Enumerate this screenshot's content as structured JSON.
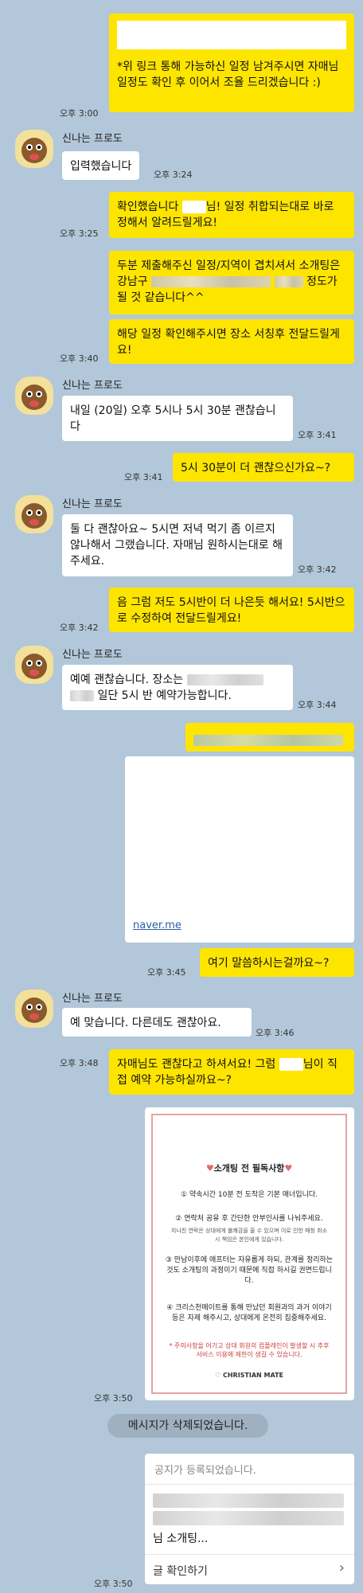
{
  "messages": {
    "m1_text": "*위 링크 통해 가능하신 일정 남겨주시면 자매님 일정도 확인 후 이어서 조율 드리겠습니다 :)",
    "m1_time": "오후 3:00",
    "sender_name": "신나는 프로도",
    "m2_text": "입력했습니다",
    "m2_time": "오후 3:24",
    "m3_text_a": "확인했습니다",
    "m3_text_b": "님! 일정 취합되는대로 바로 정해서 알려드릴게요!",
    "m3_time": "오후 3:25",
    "m4_text_a": "두분 제출해주신 일정/지역이 겹치셔서 소개팅은 강남구",
    "m4_text_b": "정도가 될 것 같습니다^^",
    "m5_text": "해당 일정 확인해주시면 장소 서칭후 전달드릴게요!",
    "m5_time": "오후 3:40",
    "m6_text": "내일 (20일) 오후 5시나 5시 30분 괜찮습니다",
    "m6_time": "오후 3:41",
    "m7_text": "5시 30분이 더 괜찮으신가요~?",
    "m7_time": "오후 3:41",
    "m8_text": "둘 다 괜찮아요~ 5시면 저녁 먹기 좀 이르지 않나해서 그랬습니다. 자매님 원하시는대로 해주세요.",
    "m8_time": "오후 3:42",
    "m9_text": "음 그럼 저도 5시반이 더 나은듯 해서요! 5시반으로 수정하여 전달드릴게요!",
    "m9_time": "오후 3:42",
    "m10_text_a": "예예 괜찮습니다. 장소는",
    "m10_text_b": "일단 5시 반 예약가능합니다.",
    "m10_time": "오후 3:44",
    "link_domain": "naver.me",
    "link_time": "오후 3:45",
    "m11_text": "여기 말씀하시는걸까요~?",
    "m12_text": "예 맞습니다. 다른데도 괜찮아요.",
    "m12_time": "오후 3:46",
    "m13_text_a": "자매님도 괜찮다고 하셔서요! 그럼",
    "m13_text_b": "님이 직접 예약 가능하실까요~?",
    "m13_time": "오후 3:48",
    "image_time": "오후 3:50",
    "deleted_text": "메시지가 삭제되었습니다.",
    "notice_header": "공지가 등록되었습니다.",
    "notice_suffix": "님 소개팅...",
    "notice_button": "글 확인하기",
    "notice_time": "오후 3:50"
  },
  "poster": {
    "title": "소개팅 전 필독사항",
    "p1": "① 약속시간 10분 전 도착은 기본 매너입니다.",
    "p2": "② 연락처 공유 후 간단한 안부인사를 나눠주세요.",
    "p2_sub": "지나친 연락은 상대에게 불쾌감을 줄 수 있으며 이로 인한 매칭 취소 시 책임은 본인에게 있습니다.",
    "p3": "③ 만남이후에 애프터는 자유롭게 하되, 관계를 정리하는 것도 소개팅의 과정이기 때문에 직접 하시길 권면드립니다.",
    "p4": "④ 크리스천메이트를 통해 만났던 회원과의 과거 이야기 등은 자제 해주시고, 상대에게 온전히 집중해주세요.",
    "warn": "* 주의사항을 어기고 상대 회원의 컴플레인이 발생할 시 추후 서비스 이용에 제한이 생길 수 있습니다.",
    "logo": "CHRISTIAN MATE"
  },
  "colors": {
    "bg": "#b2c7d9",
    "me": "#fee500",
    "you": "#ffffff",
    "link": "#2e5fa8"
  }
}
